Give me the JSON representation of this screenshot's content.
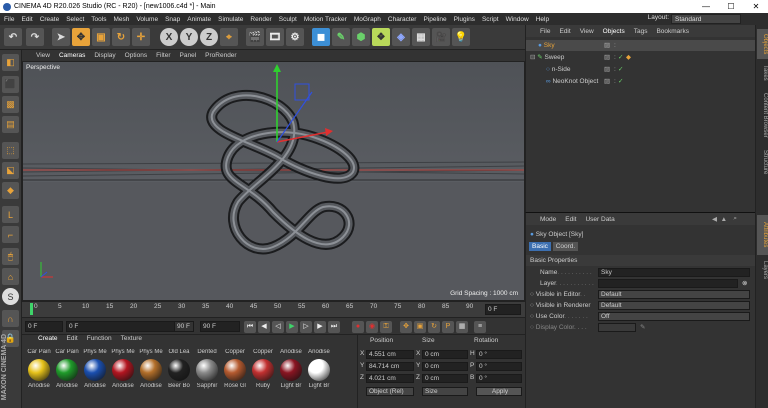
{
  "titlebar": {
    "title": "CINEMA 4D R20.026 Studio (RC - R20) - [new1006.c4d *] - Main",
    "min": "—",
    "max": "☐",
    "close": "✕"
  },
  "menubar": {
    "items": [
      "File",
      "Edit",
      "Create",
      "Select",
      "Tools",
      "Mesh",
      "Volume",
      "Snap",
      "Animate",
      "Simulate",
      "Render",
      "Sculpt",
      "Motion Tracker",
      "MoGraph",
      "Character",
      "Pipeline",
      "Plugins",
      "Script",
      "Window",
      "Help"
    ],
    "layout_label": "Layout:",
    "layout_value": "Standard"
  },
  "viewport": {
    "menu": [
      "View",
      "Cameras",
      "Display",
      "Options",
      "Filter",
      "Panel",
      "ProRender"
    ],
    "label": "Perspective",
    "grid_spacing": "Grid Spacing : 1000 cm"
  },
  "timeline": {
    "ticks": [
      "0",
      "5",
      "10",
      "15",
      "20",
      "25",
      "30",
      "35",
      "40",
      "45",
      "50",
      "55",
      "60",
      "65",
      "70",
      "75",
      "80",
      "85",
      "90"
    ],
    "current": "0 F"
  },
  "transport": {
    "start": "0 F",
    "current": "0 F",
    "end": "90 F",
    "end2": "90 F"
  },
  "materials": {
    "menu": [
      "Create",
      "Edit",
      "Function",
      "Texture"
    ],
    "items": [
      {
        "top": "Car Pain",
        "bottom": "Anodise",
        "color": "#e6c21a"
      },
      {
        "top": "Car Pain",
        "bottom": "Anodise",
        "color": "#1f9b2a"
      },
      {
        "top": "Phys Me",
        "bottom": "Anodise",
        "color": "#1a4fb0"
      },
      {
        "top": "Phys Me",
        "bottom": "Anodise",
        "color": "#b31520"
      },
      {
        "top": "Phys Me",
        "bottom": "Anodise",
        "color": "#b36f2a"
      },
      {
        "top": "Old Lea",
        "bottom": "Beer Bo",
        "color": "#222222"
      },
      {
        "top": "Dented",
        "bottom": "Sapphir",
        "color": "#8a8a8a"
      },
      {
        "top": "Copper",
        "bottom": "Rose Gl",
        "color": "#b55a2f"
      },
      {
        "top": "Copper",
        "bottom": "Ruby",
        "color": "#c23030"
      },
      {
        "top": "Anodise",
        "bottom": "Light Br",
        "color": "#8a1522"
      },
      {
        "top": "Anodise",
        "bottom": "Light Br",
        "color": "#ffffff"
      }
    ]
  },
  "coordinates": {
    "headers": [
      "Position",
      "Size",
      "Rotation"
    ],
    "rows": [
      {
        "axis": "X",
        "pos": "4.551 cm",
        "sizeAxis": "X",
        "size": "0 cm",
        "rotAxis": "H",
        "rot": "0 °"
      },
      {
        "axis": "Y",
        "pos": "84.714 cm",
        "sizeAxis": "Y",
        "size": "0 cm",
        "rotAxis": "P",
        "rot": "0 °"
      },
      {
        "axis": "Z",
        "pos": "4.021 cm",
        "sizeAxis": "Z",
        "size": "0 cm",
        "rotAxis": "B",
        "rot": "0 °"
      }
    ],
    "mode": "Object (Rel)",
    "size_mode": "Size",
    "apply": "Apply"
  },
  "objects": {
    "menu": [
      "File",
      "Edit",
      "View",
      "Objects",
      "Tags",
      "Bookmarks"
    ],
    "items": [
      {
        "name": "Sky",
        "icon_color": "#5a9be0"
      },
      {
        "name": "Sweep",
        "icon_color": "#6ad06a"
      },
      {
        "name": "n-Side",
        "icon_color": "#5a9be0"
      },
      {
        "name": "NeoKnot Object",
        "icon_color": "#5a9be0"
      }
    ]
  },
  "attributes": {
    "menu": [
      "Mode",
      "Edit",
      "User Data"
    ],
    "object": "Sky Object [Sky]",
    "tabs": [
      "Basic",
      "Coord."
    ],
    "section": "Basic Properties",
    "fields": [
      {
        "label": "Name",
        "value": "Sky"
      },
      {
        "label": "Layer",
        "value": ""
      },
      {
        "label": "Visible in Editor",
        "value": "Default"
      },
      {
        "label": "Visible in Renderer",
        "value": "Default"
      },
      {
        "label": "Use Color",
        "value": "Off"
      },
      {
        "label": "Display Color",
        "value": ""
      }
    ]
  },
  "right_tabs": [
    "Objects",
    "Takes",
    "Content Browser",
    "Structure",
    "Attributes",
    "Layers"
  ],
  "brand": "MAXON CINEMA 4D"
}
